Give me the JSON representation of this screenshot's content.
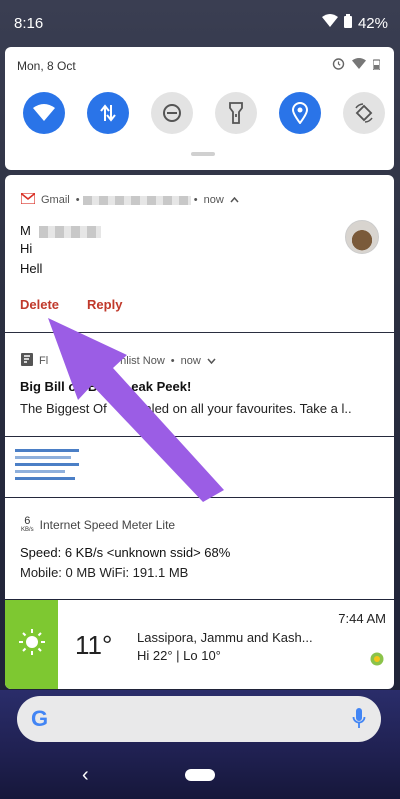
{
  "status_bar": {
    "time": "8:16",
    "battery": "42%"
  },
  "quick_settings": {
    "date": "Mon, 8 Oct",
    "tiles": [
      "wifi",
      "mobile-data",
      "do-not-disturb",
      "flashlight",
      "location",
      "auto-rotate"
    ]
  },
  "gmail_notification": {
    "app_name": "Gmail",
    "time": "now",
    "sender": "M",
    "line1": "Hi",
    "line2": "Hell",
    "actions": {
      "delete": "Delete",
      "reply": "Reply"
    }
  },
  "flipkart_notification": {
    "app_fragment": "Fl",
    "header_rest": "hlist Now",
    "time": "now",
    "title": "Big Bill on B",
    "title_rest": "eak Peek!",
    "body_start": "The Biggest Of",
    "body_rest": "vealed on all your favourites. Take a l.."
  },
  "speed_meter_notification": {
    "icon_number": "6",
    "icon_unit": "KB/s",
    "app_name": "Internet Speed Meter Lite",
    "speed_line": "Speed: 6 KB/s   <unknown ssid> 68%",
    "data_line": "Mobile: 0 MB    WiFi: 191.1 MB"
  },
  "weather_notification": {
    "temperature": "11°",
    "location": "Lassipora, Jammu and Kash...",
    "hi_lo": "Hi 22° | Lo 10°",
    "time": "7:44 AM"
  },
  "search_bar": {
    "logo": "G"
  },
  "colors": {
    "accent_blue": "#2a74e8",
    "gmail_red": "#c0392b",
    "weather_green": "#7ec831",
    "arrow_purple": "#9b5de5"
  }
}
